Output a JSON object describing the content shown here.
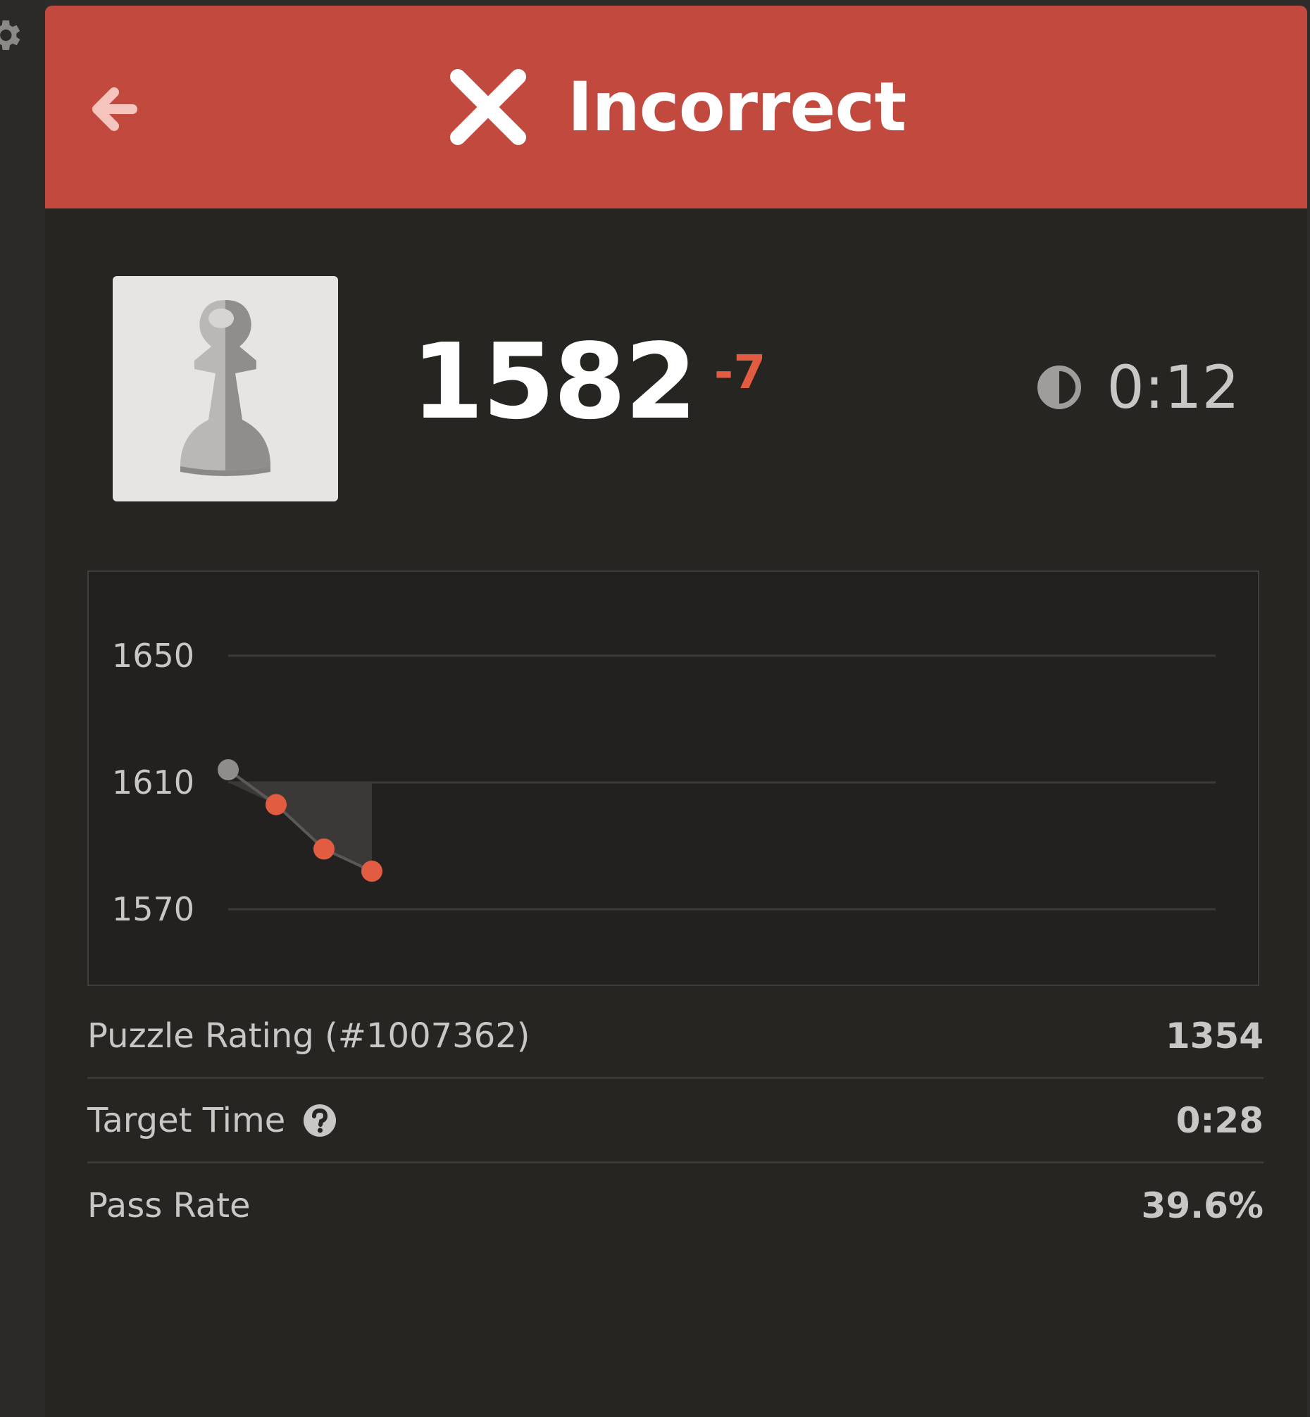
{
  "header": {
    "title": "Incorrect",
    "color": "#c1493e"
  },
  "player": {
    "rating": "1582",
    "rating_delta": "-7",
    "timer": "0:12"
  },
  "chart_data": {
    "type": "line",
    "x": [
      1,
      2,
      3,
      4
    ],
    "series": [
      {
        "values": [
          1614,
          1603,
          1589,
          1582
        ]
      }
    ],
    "yticks": [
      "1650",
      "1610",
      "1570"
    ],
    "ylim": [
      1570,
      1650
    ],
    "grid": true,
    "point_colors": [
      "#8e8d8b",
      "#e25c42",
      "#e25c42",
      "#e25c42"
    ]
  },
  "stats": [
    {
      "label": "Puzzle Rating (#1007362)",
      "value": "1354"
    },
    {
      "label": "Target Time",
      "value": "0:28"
    },
    {
      "label": "Pass Rate",
      "value": "39.6%"
    }
  ],
  "icons": {
    "back": "arrow-left-icon",
    "result": "x-icon",
    "piece": "pawn-icon",
    "timer": "clock-icon",
    "help": "question-icon",
    "settings": "gear-icon"
  }
}
